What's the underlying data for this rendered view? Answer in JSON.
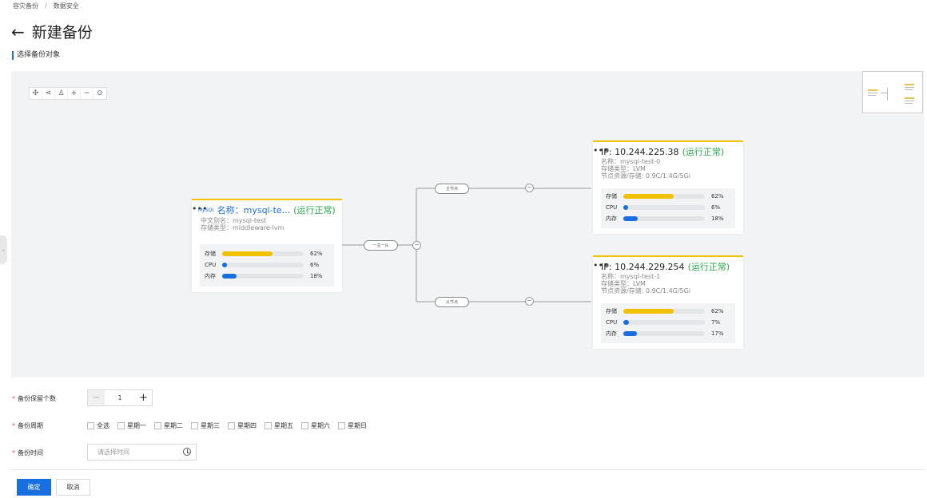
{
  "breadcrumb": [
    "容灾备份",
    "数据安全"
  ],
  "page": {
    "back_icon": "arrow-left-icon",
    "title": "新建备份"
  },
  "section_label": "选择备份对象",
  "toolbar": {
    "buttons": [
      {
        "name": "move-icon",
        "glyph": "✣"
      },
      {
        "name": "layout-horizontal-icon",
        "glyph": "⋖"
      },
      {
        "name": "layout-vertical-icon",
        "glyph": "♙"
      },
      {
        "name": "zoom-in-icon",
        "glyph": "+"
      },
      {
        "name": "zoom-out-icon",
        "glyph": "−"
      },
      {
        "name": "fit-view-icon",
        "glyph": "⊙"
      }
    ]
  },
  "topology": {
    "edge_labels": {
      "main": "一主一从",
      "master": "主节点",
      "slave": "从节点"
    },
    "source": {
      "logo_text": "MySQL",
      "name": "名称：mysql-te...",
      "status": "(运行正常)",
      "more": "•••",
      "lines": [
        "中文别名：mysql-test",
        "存储类型：middleware-lvm"
      ],
      "metrics": [
        {
          "label": "存储",
          "percent": 62,
          "text": "62%",
          "color": "#f2c200"
        },
        {
          "label": "CPU",
          "percent": 6,
          "text": "6%",
          "color": "#1a6fe0"
        },
        {
          "label": "内存",
          "percent": 18,
          "text": "18%",
          "color": "#1a6fe0"
        }
      ]
    },
    "nodes": [
      {
        "ip": "IP: 10.244.225.38",
        "status": "(运行正常)",
        "more": "•••",
        "lines": [
          "名称：mysql-test-0",
          "存储类型：LVM",
          "节点资源/存储: 0.9C/1.4G/5Gi"
        ],
        "metrics": [
          {
            "label": "存储",
            "percent": 62,
            "text": "62%",
            "color": "#f2c200"
          },
          {
            "label": "CPU",
            "percent": 6,
            "text": "6%",
            "color": "#1a6fe0"
          },
          {
            "label": "内存",
            "percent": 18,
            "text": "18%",
            "color": "#1a6fe0"
          }
        ]
      },
      {
        "ip": "IP: 10.244.229.254",
        "status": "(运行正常)",
        "more": "•••",
        "lines": [
          "名称：mysql-test-1",
          "存储类型：LVM",
          "节点资源/存储: 0.9C/1.4G/5Gi"
        ],
        "metrics": [
          {
            "label": "存储",
            "percent": 62,
            "text": "62%",
            "color": "#f2c200"
          },
          {
            "label": "CPU",
            "percent": 7,
            "text": "7%",
            "color": "#1a6fe0"
          },
          {
            "label": "内存",
            "percent": 17,
            "text": "17%",
            "color": "#1a6fe0"
          }
        ]
      }
    ]
  },
  "form": {
    "retain_label": "备份保留个数",
    "retain_value": "1",
    "period_label": "备份周期",
    "weekdays": [
      "全选",
      "星期一",
      "星期二",
      "星期三",
      "星期四",
      "星期五",
      "星期六",
      "星期日"
    ],
    "time_label": "备份时间",
    "time_placeholder": "请选择时间"
  },
  "actions": {
    "ok": "确定",
    "cancel": "取消"
  },
  "colors": {
    "accent": "#1a6fe0",
    "status_ok": "#2aa84a",
    "storage": "#f2c200"
  }
}
